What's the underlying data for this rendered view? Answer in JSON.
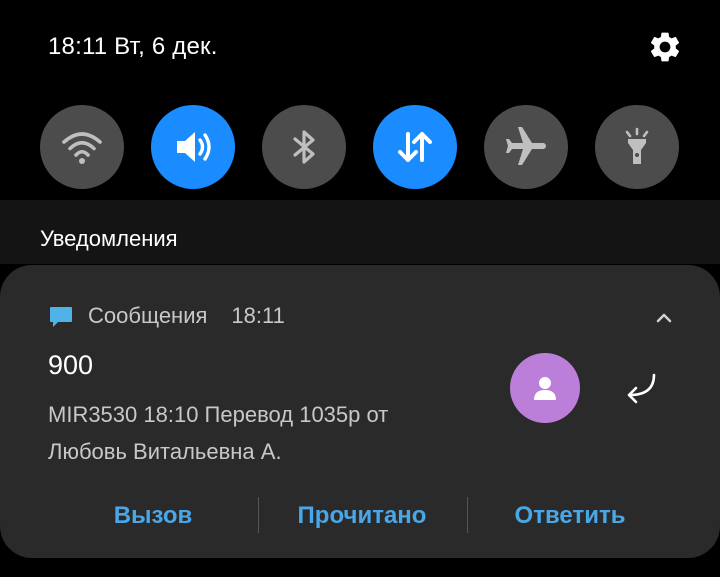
{
  "status": {
    "datetime": "18:11 Вт, 6 дек.",
    "settings_icon": "gear-icon"
  },
  "quick_settings": [
    {
      "name": "wifi",
      "icon": "wifi-icon",
      "active": false
    },
    {
      "name": "sound",
      "icon": "volume-icon",
      "active": true
    },
    {
      "name": "bluetooth",
      "icon": "bluetooth-icon",
      "active": false
    },
    {
      "name": "mobile-data",
      "icon": "data-transfer-icon",
      "active": true
    },
    {
      "name": "airplane-mode",
      "icon": "airplane-icon",
      "active": false
    },
    {
      "name": "flashlight",
      "icon": "flashlight-icon",
      "active": false
    }
  ],
  "colors": {
    "tile_active": "#1a8cff",
    "tile_inactive": "#4c4c4c",
    "accent": "#49a7e8",
    "avatar": "#bb7fd9",
    "app_icon": "#4fb3e8"
  },
  "notifications_section": {
    "title": "Уведомления"
  },
  "notification": {
    "app_name": "Сообщения",
    "time": "18:11",
    "sender": "900",
    "message_line1": "MIR3530 18:10 Перевод 1035р от",
    "message_line2": "Любовь Витальевна А.",
    "actions": {
      "call": "Вызов",
      "mark_read": "Прочитано",
      "reply": "Ответить"
    }
  }
}
